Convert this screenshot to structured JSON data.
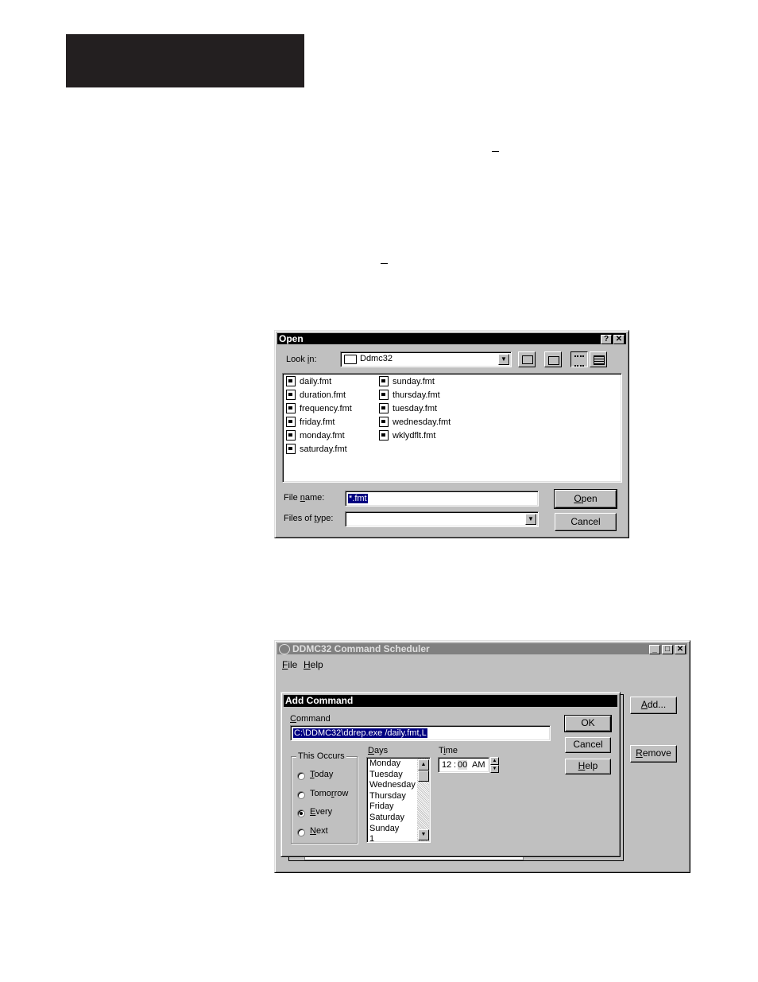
{
  "open_dialog": {
    "title": "Open",
    "help_btn": "?",
    "close_btn": "✕",
    "look_in_label_pre": "Look ",
    "look_in_label_u": "i",
    "look_in_label_post": "n:",
    "look_in_value": "Ddmc32",
    "files_col1": [
      "daily.fmt",
      "duration.fmt",
      "frequency.fmt",
      "friday.fmt",
      "monday.fmt",
      "saturday.fmt"
    ],
    "files_col2": [
      "sunday.fmt",
      "thursday.fmt",
      "tuesday.fmt",
      "wednesday.fmt",
      "wklydflt.fmt"
    ],
    "file_name_label_pre": "File ",
    "file_name_label_u": "n",
    "file_name_label_post": "ame:",
    "file_name_value": "*.fmt",
    "files_of_type_label_pre": "Files of ",
    "files_of_type_label_u": "t",
    "files_of_type_label_post": "ype:",
    "files_of_type_value": "",
    "open_btn_u": "O",
    "open_btn_post": "pen",
    "cancel_btn": "Cancel"
  },
  "scheduler": {
    "title": "DDMC32 Command Scheduler",
    "menu_file_u": "F",
    "menu_file_post": "ile",
    "menu_help_u": "H",
    "menu_help_post": "elp",
    "add_btn_u": "A",
    "add_btn_post": "dd...",
    "remove_btn_u": "R",
    "remove_btn_post": "emove"
  },
  "add_command": {
    "title": "Add Command",
    "command_label_u": "C",
    "command_label_post": "ommand",
    "command_value": "C:\\DDMC32\\ddrep.exe /daily.fmt,L",
    "ok_btn": "OK",
    "cancel_btn": "Cancel",
    "help_btn_u": "H",
    "help_btn_post": "elp",
    "this_occurs_label": "This Occurs",
    "radio_today_u": "T",
    "radio_today_post": "oday",
    "radio_tomorrow_pre": "Tomo",
    "radio_tomorrow_u": "r",
    "radio_tomorrow_post": "row",
    "radio_every_u": "E",
    "radio_every_post": "very",
    "radio_next_u": "N",
    "radio_next_post": "ext",
    "days_label_u": "D",
    "days_label_post": "ays",
    "days": [
      "Monday",
      "Tuesday",
      "Wednesday",
      "Thursday",
      "Friday",
      "Saturday",
      "Sunday",
      "1"
    ],
    "time_label_pre": "T",
    "time_label_u": "i",
    "time_label_post": "me",
    "time_hour": "12",
    "time_sep": ":",
    "time_min": "00",
    "time_ampm": "AM"
  }
}
